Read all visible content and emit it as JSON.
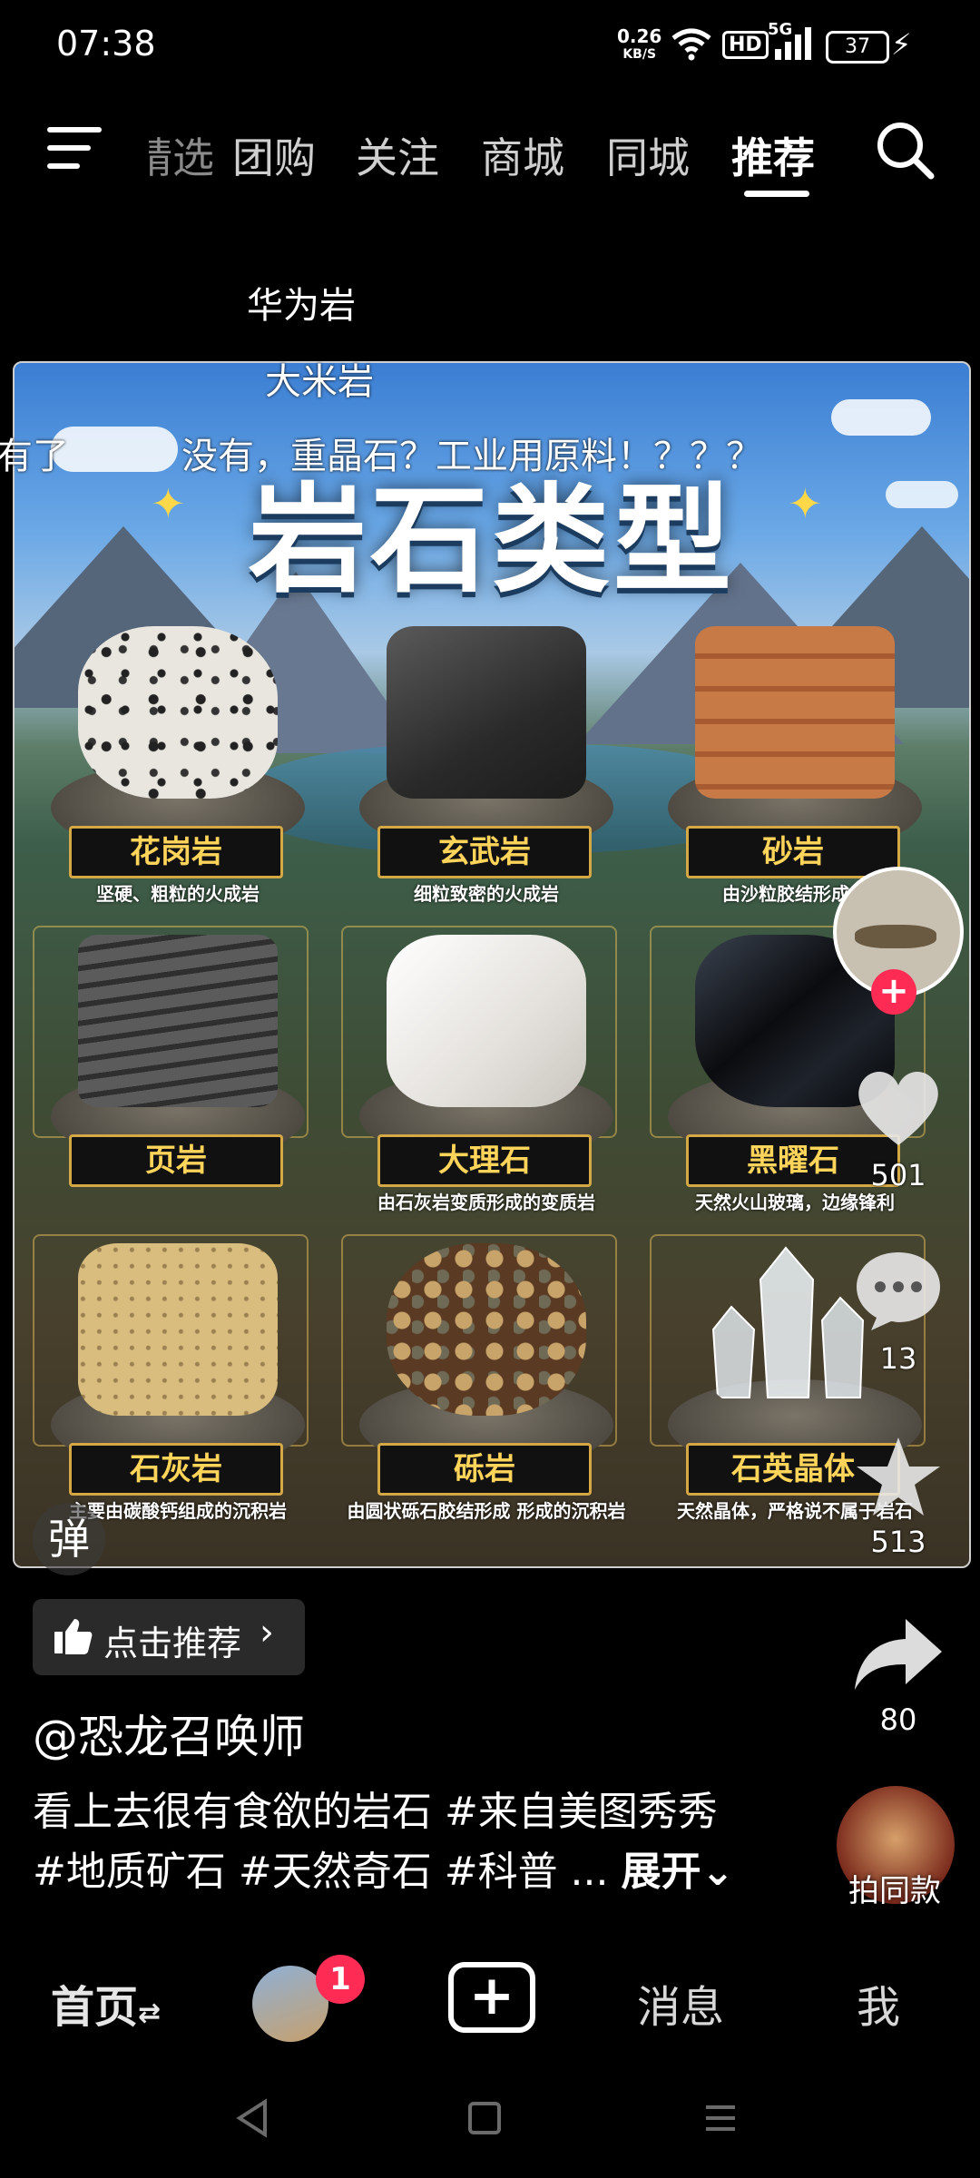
{
  "status_bar": {
    "time": "07:38",
    "net_speed_value": "0.26",
    "net_speed_unit": "KB/S",
    "hd_label": "HD",
    "signal_label": "5G",
    "battery": "37"
  },
  "top_nav": {
    "tabs": [
      {
        "label": "精选"
      },
      {
        "label": "团购"
      },
      {
        "label": "关注"
      },
      {
        "label": "商城"
      },
      {
        "label": "同城"
      },
      {
        "label": "推荐"
      }
    ],
    "active_tab": "推荐"
  },
  "danmaku": [
    {
      "text": "华为岩"
    },
    {
      "text": "大米岩"
    },
    {
      "text": "有了"
    },
    {
      "text": "没有，重晶石？工业用原料！？？？"
    }
  ],
  "poster": {
    "title": "岩石类型",
    "rocks": [
      {
        "name": "花岗岩",
        "desc": "坚硬、粗粒的火成岩"
      },
      {
        "name": "玄武岩",
        "desc": "细粒致密的火成岩"
      },
      {
        "name": "砂岩",
        "desc": "由沙粒胶结形成的"
      },
      {
        "name": "页岩",
        "desc": ""
      },
      {
        "name": "大理石",
        "desc": "由石灰岩变质形成的变质岩"
      },
      {
        "name": "黑曜石",
        "desc": "天然火山玻璃，边缘锋利"
      },
      {
        "name": "石灰岩",
        "desc": "主要由碳酸钙组成的沉积岩"
      },
      {
        "name": "砾岩",
        "desc": "由圆状砾石胶结形成 形成的沉积岩"
      },
      {
        "name": "石英晶体",
        "desc": "天然晶体，严格说不属于岩石"
      }
    ],
    "colors": {
      "plate_border": "#d4a845",
      "plate_text": "#ffd45a"
    }
  },
  "danmaku_toggle": "弹",
  "actions": {
    "likes": "501",
    "comments": "13",
    "favorites": "513",
    "shares": "80",
    "same_style_label": "拍同款"
  },
  "video_info": {
    "recommend_chip": "点击推荐",
    "author": "@恐龙召唤师",
    "caption_line1": "看上去很有食欲的岩石 #来自美图秀秀",
    "caption_line2": "#地质矿石 #天然奇石 #科普 ...",
    "expand_label": "展开"
  },
  "bottom_nav": {
    "home": "首页",
    "friends_badge": "1",
    "create": "+",
    "messages": "消息",
    "me": "我"
  },
  "accent_colors": {
    "red": "#fe2c55",
    "gold": "#d4a845"
  }
}
